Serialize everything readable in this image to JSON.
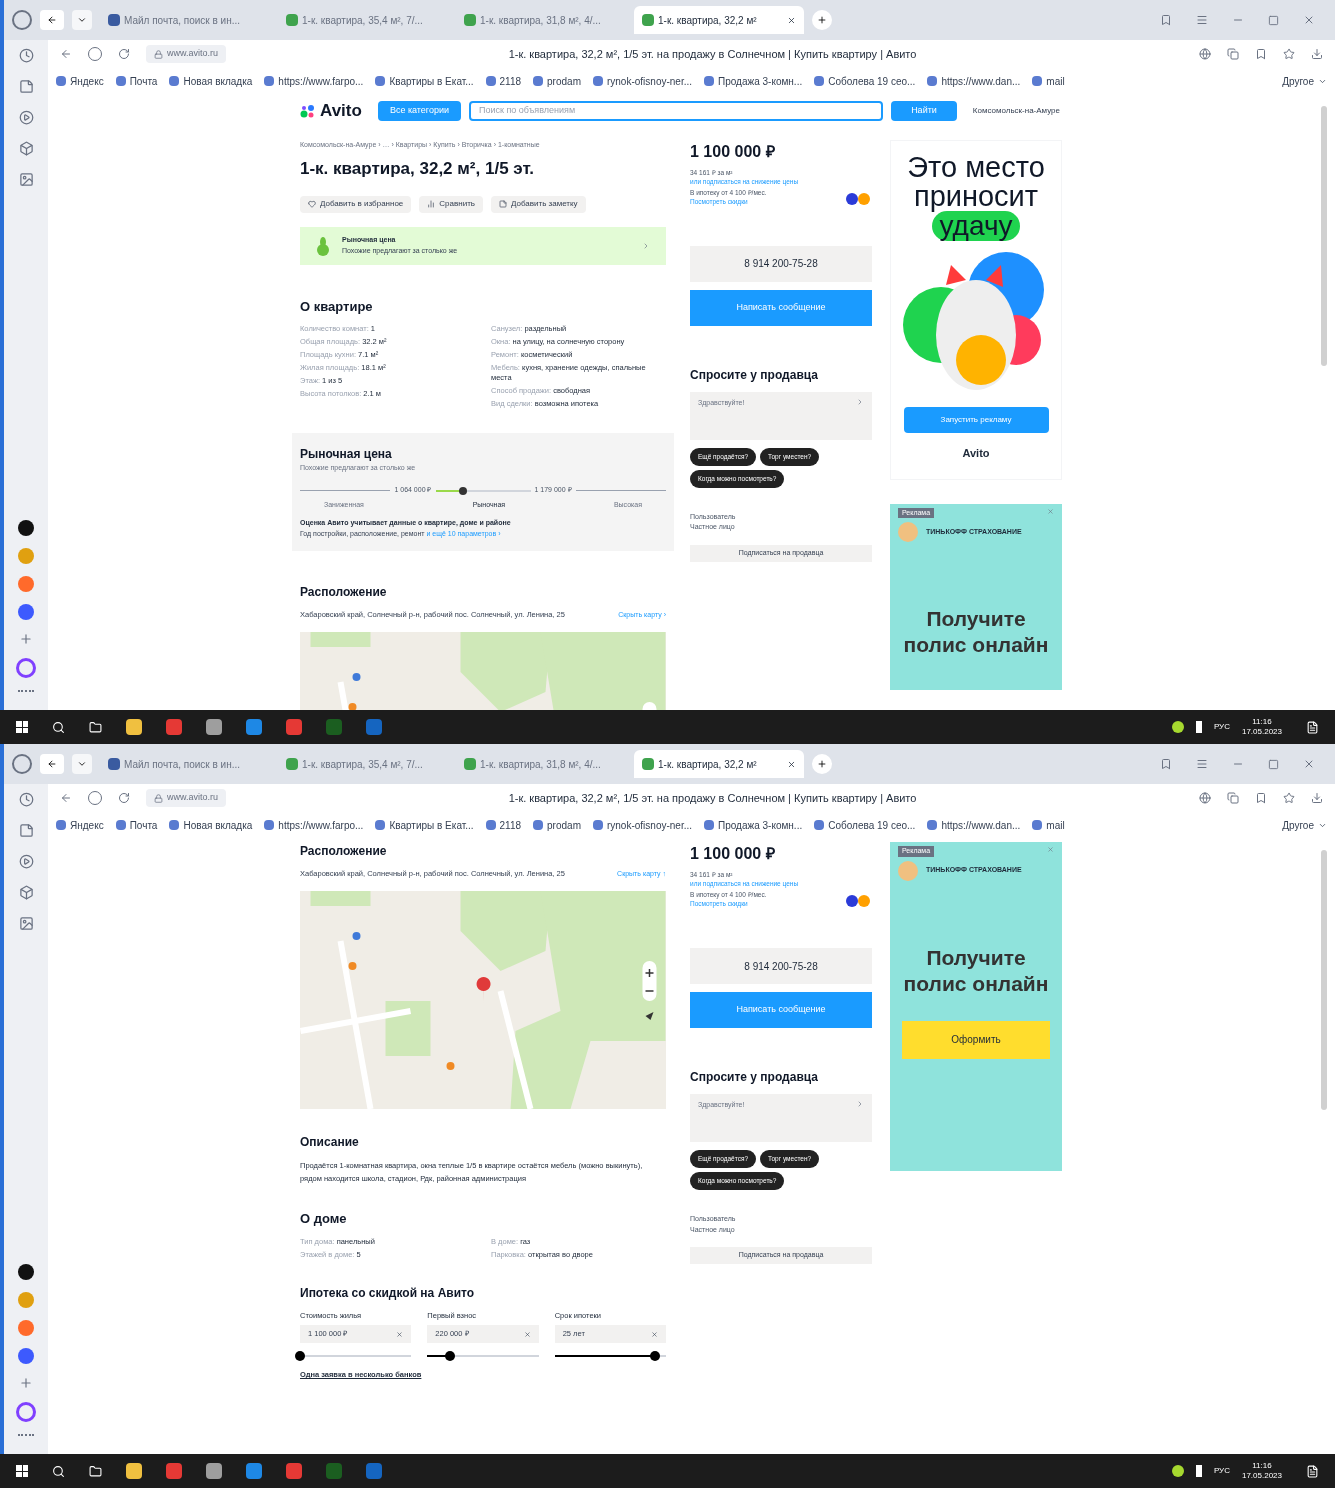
{
  "screens": [
    {
      "tabs": [
        {
          "label": "Майл почта, поиск в ин...",
          "selected": false
        },
        {
          "label": "1-к. квартира, 35,4 м², 7/...",
          "selected": false
        },
        {
          "label": "1-к. квартира, 31,8 м², 4/...",
          "selected": false
        },
        {
          "label": "1-к. квартира, 32,2 м²",
          "selected": true
        }
      ],
      "address": "www.avito.ru",
      "page_title": "1-к. квартира, 32,2 м², 1/5 эт. на продажу в Солнечном | Купить квартиру | Авито",
      "bookmarks": [
        "Яндекс",
        "Почта",
        "Новая вкладка",
        "https://www.farpo...",
        "Квартиры в Екат...",
        "2118",
        "prodam",
        "rynok-ofisnoy-ner...",
        "Продажа 3-комн...",
        "Соболева 19 сео...",
        "https://www.dan...",
        "mail"
      ],
      "bookmarks_more": "Другое",
      "header": {
        "logo": "Avito",
        "categories": "Все категории",
        "search_placeholder": "Поиск по объявлениям",
        "search_button": "Найти",
        "location": "Комсомольск-на-Амуре"
      },
      "main": [
        {
          "kind": "title",
          "breadcrumbs": "Комсомольск-на-Амуре › … › Квартиры › Купить › Вторичка › 1-комнатные",
          "title": "1-к. квартира, 32,2 м², 1/5 эт.",
          "actions": [
            "Добавить в избранное",
            "Сравнить",
            "Добавить заметку"
          ],
          "banner_title": "Рыночная цена",
          "banner_text": "Похожие предлагают за столько же"
        },
        {
          "kind": "params",
          "heading": "О квартире",
          "columns": [
            [
              {
                "label": "Количество комнат:",
                "value": "1"
              },
              {
                "label": "Общая площадь:",
                "value": "32.2 м²"
              },
              {
                "label": "Площадь кухни:",
                "value": "7.1 м²"
              },
              {
                "label": "Жилая площадь:",
                "value": "18.1 м²"
              },
              {
                "label": "Этаж:",
                "value": "1 из 5"
              },
              {
                "label": "Высота потолков:",
                "value": "2.1 м"
              }
            ],
            [
              {
                "label": "Санузел:",
                "value": "раздельный"
              },
              {
                "label": "Окна:",
                "value": "на улицу, на солнечную сторону"
              },
              {
                "label": "Ремонт:",
                "value": "косметический"
              },
              {
                "label": "Мебель:",
                "value": "кухня, хранение одежды, спальные места"
              },
              {
                "label": "Способ продажи:",
                "value": "свободная"
              },
              {
                "label": "Вид сделки:",
                "value": "возможна ипотека"
              }
            ]
          ]
        },
        {
          "kind": "market",
          "heading": "Рыночная цена",
          "subtitle": "Похожие предлагают за столько же",
          "low": "1 064 000 ₽",
          "high": "1 179 000 ₽",
          "level": 0.3,
          "scale": [
            "Заниженная",
            "Рыночная",
            "Высокая"
          ],
          "note_bold": "Оценка Авито учитывает данные о квартире, доме и районе",
          "note": "Год постройки, расположение, ремонт",
          "link": "и ещё 10 параметров ›"
        },
        {
          "kind": "location",
          "heading": "Расположение",
          "address": "Хабаровский край, Солнечный р-н, рабочий пос. Солнечный, ул. Ленина, 25",
          "link": "Скрыть карту ›"
        }
      ],
      "price": {
        "price": "1 100 000 ₽",
        "per_m2": "34 161 ₽ за м²",
        "subscribe": "или подписаться на снижение цены",
        "mortgage": "В ипотеку от 4 100 ₽/мес.",
        "discounts": "Посмотреть скидки",
        "phone": "8 914 200-75-28",
        "message": "Написать сообщение",
        "ask_heading": "Спросите у продавца",
        "ask_placeholder": "Здравствуйте!",
        "chips": [
          "Ещё продаётся?",
          "Торг уместен?",
          "Когда можно посмотреть?"
        ],
        "seller": "Пользователь",
        "seller_type": "Частное лицо",
        "subscribe_seller": "Подписаться на продавца"
      },
      "ads": [
        {
          "kind": "luck",
          "lines": [
            "Это место",
            "приносит"
          ],
          "highlight": "удачу",
          "button": "Запустить рекламу",
          "logo": "Avito"
        },
        {
          "kind": "insurance",
          "tag": "Реклама",
          "brand": "ТИНЬКОФФ СТРАХОВАНИЕ",
          "headline": "Получите полис онлайн"
        }
      ],
      "taskbar": {
        "lang": "РУС",
        "time": "11:16",
        "date": "17.05.2023"
      }
    },
    {
      "tabs": [
        {
          "label": "Майл почта, поиск в ин...",
          "selected": false
        },
        {
          "label": "1-к. квартира, 35,4 м², 7/...",
          "selected": false
        },
        {
          "label": "1-к. квартира, 31,8 м², 4/...",
          "selected": false
        },
        {
          "label": "1-к. квартира, 32,2 м²",
          "selected": true
        }
      ],
      "address": "www.avito.ru",
      "page_title": "1-к. квартира, 32,2 м², 1/5 эт. на продажу в Солнечном | Купить квартиру | Авито",
      "bookmarks": [
        "Яндекс",
        "Почта",
        "Новая вкладка",
        "https://www.farpo...",
        "Квартиры в Екат...",
        "2118",
        "prodam",
        "rynok-ofisnoy-ner...",
        "Продажа 3-комн...",
        "Соболева 19 сео...",
        "https://www.dan...",
        "mail"
      ],
      "bookmarks_more": "Другое",
      "main": [
        {
          "kind": "location",
          "heading": "Расположение",
          "address": "Хабаровский край, Солнечный р-н, рабочий пос. Солнечный, ул. Ленина, 25",
          "link": "Скрыть карту ↑"
        },
        {
          "kind": "text",
          "heading": "Описание",
          "body": "Продаётся 1-комнатная квартира, окна теплые 1/5 в квартире остаётся мебель (можно выкинуть), рядом находится школа, стадион, Рдк, районная администрация"
        },
        {
          "kind": "params",
          "heading": "О доме",
          "columns": [
            [
              {
                "label": "Тип дома:",
                "value": "панельный"
              },
              {
                "label": "Этажей в доме:",
                "value": "5"
              }
            ],
            [
              {
                "label": "В доме:",
                "value": "газ"
              },
              {
                "label": "Парковка:",
                "value": "открытая во дворе"
              }
            ]
          ]
        },
        {
          "kind": "mortgage",
          "heading": "Ипотека со скидкой на Авито",
          "fields": [
            {
              "label": "Стоимость жилья",
              "value": "1 100 000 ₽",
              "level": 0
            },
            {
              "label": "Первый взнос",
              "value": "220 000 ₽",
              "level": 0.2
            },
            {
              "label": "Срок ипотеки",
              "value": "25 лет",
              "level": 0.9
            }
          ],
          "footer": "Одна заявка в несколько банков"
        }
      ],
      "price": {
        "price": "1 100 000 ₽",
        "per_m2": "34 161 ₽ за м²",
        "subscribe": "или подписаться на снижение цены",
        "mortgage": "В ипотеку от 4 100 ₽/мес.",
        "discounts": "Посмотреть скидки",
        "phone": "8 914 200-75-28",
        "message": "Написать сообщение",
        "ask_heading": "Спросите у продавца",
        "ask_placeholder": "Здравствуйте!",
        "chips": [
          "Ещё продаётся?",
          "Торг уместен?",
          "Когда можно посмотреть?"
        ],
        "seller": "Пользователь",
        "seller_type": "Частное лицо",
        "subscribe_seller": "Подписаться на продавца"
      },
      "ads": [
        {
          "kind": "insurance",
          "tag": "Реклама",
          "brand": "ТИНЬКОФФ СТРАХОВАНИЕ",
          "headline": "Получите полис онлайн",
          "button": "Оформить"
        }
      ],
      "taskbar": {
        "lang": "РУС",
        "time": "11:16",
        "date": "17.05.2023"
      }
    }
  ]
}
